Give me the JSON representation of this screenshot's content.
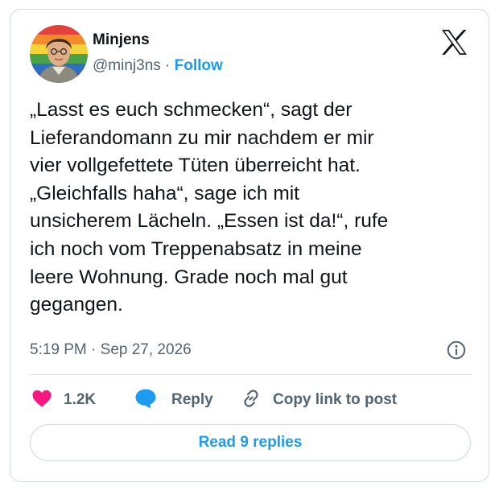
{
  "author": {
    "name": "Minjens",
    "handle": "@minj3ns",
    "separator": " · ",
    "follow_label": "Follow"
  },
  "tweet": {
    "lines": [
      "„Lasst es euch schmecken“, sagt der",
      "Lieferandomann zu mir nachdem er mir",
      "vier vollgefettete Tüten überreicht hat.",
      "„Gleichfalls haha“,  sage ich mit",
      "unsicherem Lächeln. „Essen ist da!“, rufe",
      "ich noch vom Treppenabsatz in meine",
      "leere Wohnung. Grade noch mal gut",
      "gegangen."
    ],
    "time": "5:19 PM",
    "date": "Sep 27, 2026",
    "timestamp_sep": " · "
  },
  "actions": {
    "like_count": "1.2K",
    "reply_label": "Reply",
    "copy_label": "Copy link to post"
  },
  "read_replies_label": "Read 9 replies",
  "icons": {
    "logo": "x-logo-icon",
    "info": "info-icon",
    "like": "heart-icon",
    "reply": "speech-bubble-icon",
    "copy": "link-icon"
  },
  "colors": {
    "accent": "#1d9bf0",
    "like": "#f91880",
    "text": "#0f1419",
    "secondary": "#536471",
    "border": "#cfd9de"
  }
}
